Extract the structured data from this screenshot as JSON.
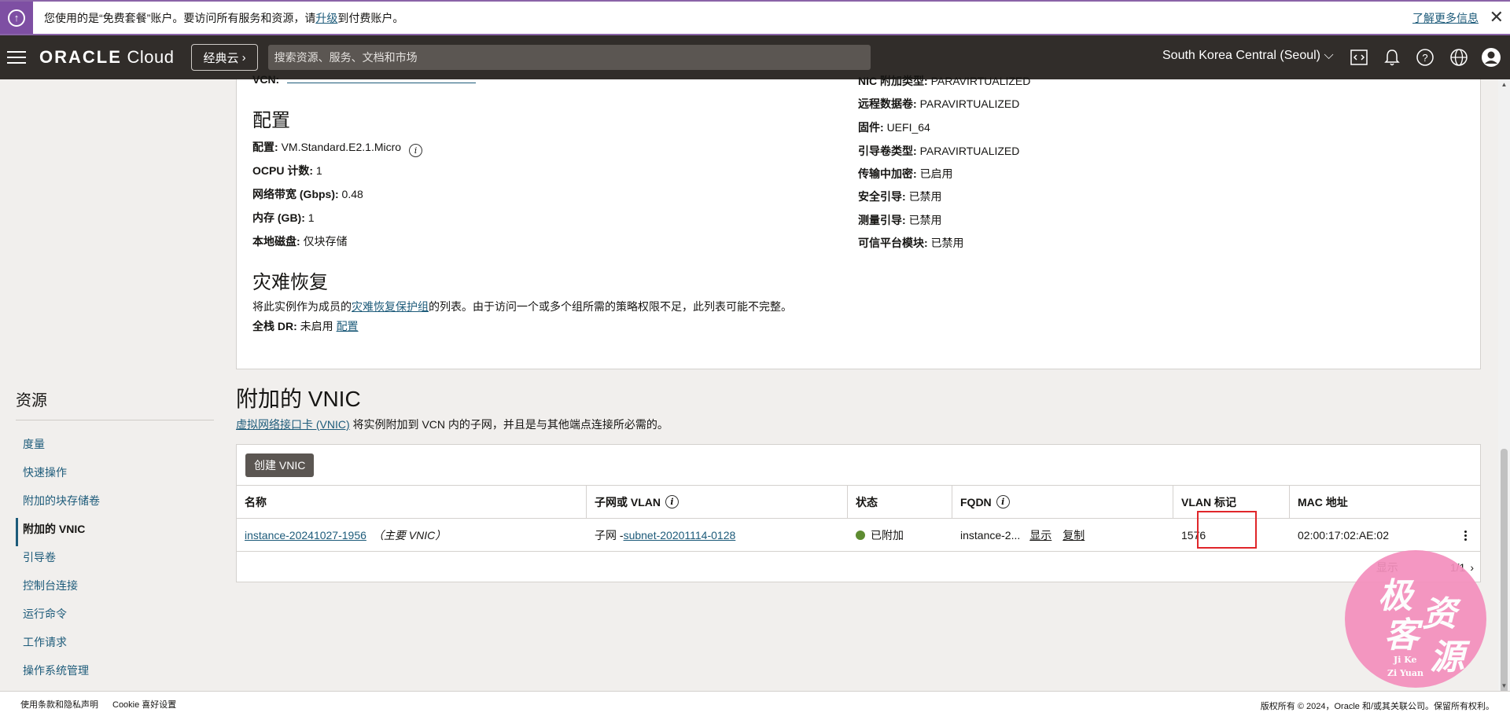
{
  "banner": {
    "text_before": "您使用的是“免费套餐”账户。要访问所有服务和资源，请",
    "upgrade_link": "升级",
    "text_after": "到付费账户。",
    "learn_more": "了解更多信息"
  },
  "topnav": {
    "logo_oracle": "ORACLE",
    "logo_cloud": " Cloud",
    "classic_label": "经典云",
    "search_placeholder": "搜索资源、服务、文档和市场",
    "region": "South Korea Central (Seoul)"
  },
  "details": {
    "left": {
      "config_heading": "配置",
      "shape_label": "配置:",
      "shape_value": "VM.Standard.E2.1.Micro",
      "ocpu_label": "OCPU 计数:",
      "ocpu_value": "1",
      "bandwidth_label": "网络带宽 (Gbps):",
      "bandwidth_value": "0.48",
      "memory_label": "内存 (GB):",
      "memory_value": "1",
      "local_disk_label": "本地磁盘:",
      "local_disk_value": "仅块存储",
      "dr_heading": "灾难恢复",
      "dr_text_before": "将此实例作为成员的",
      "dr_link": "灾难恢复保护组",
      "dr_text_after": "的列表。由于访问一个或多个组所需的策略权限不足，此列表可能不完整。",
      "full_dr_label": "全栈 DR:",
      "full_dr_value": "未启用",
      "full_dr_link": "配置"
    },
    "right": {
      "nic_label": "NIC 附加类型:",
      "nic_value": "PARAVIRTUALIZED",
      "remote_vol_label": "远程数据卷:",
      "remote_vol_value": "PARAVIRTUALIZED",
      "firmware_label": "固件:",
      "firmware_value": "UEFI_64",
      "boot_vol_label": "引导卷类型:",
      "boot_vol_value": "PARAVIRTUALIZED",
      "transit_enc_label": "传输中加密:",
      "transit_enc_value": "已启用",
      "secure_boot_label": "安全引导:",
      "secure_boot_value": "已禁用",
      "measured_boot_label": "测量引导:",
      "measured_boot_value": "已禁用",
      "tpm_label": "可信平台模块:",
      "tpm_value": "已禁用"
    }
  },
  "sidebar": {
    "title": "资源",
    "items": [
      {
        "label": "度量"
      },
      {
        "label": "快速操作"
      },
      {
        "label": "附加的块存储卷"
      },
      {
        "label": "附加的 VNIC"
      },
      {
        "label": "引导卷"
      },
      {
        "label": "控制台连接"
      },
      {
        "label": "运行命令"
      },
      {
        "label": "工作请求"
      },
      {
        "label": "操作系统管理"
      }
    ]
  },
  "vnic": {
    "title": "附加的 VNIC",
    "desc_link": "虚拟网络接口卡 (VNIC)",
    "desc_text": " 将实例附加到 VCN 内的子网，并且是与其他端点连接所必需的。",
    "create_button": "创建 VNIC",
    "columns": [
      "名称",
      "子网或 VLAN",
      "状态",
      "FQDN",
      "VLAN 标记",
      "MAC 地址"
    ],
    "row": {
      "name_link": "instance-20241027-1956",
      "name_tag": "（主要 VNIC）",
      "subnet_prefix": "子网 - ",
      "subnet_link": "subnet-20201114-0128",
      "status": "已附加",
      "fqdn": "instance-2...",
      "fqdn_show": "显示",
      "fqdn_copy": "复制",
      "vlan_tag": "1576",
      "mac": "02:00:17:02:AE:02"
    },
    "pager": {
      "label": "显示",
      "range": "1/1"
    },
    "status_color": "#5e8c31"
  },
  "footer": {
    "terms": "使用条款和隐私声明",
    "cookie": "Cookie 喜好设置",
    "copyright": "版权所有 © 2024，Oracle 和/或其关联公司。保留所有权利。"
  },
  "watermark": {
    "chars": [
      "极",
      "客",
      "资",
      "源"
    ],
    "line1": "Ji Ke",
    "line2": "Zi Yuan"
  }
}
